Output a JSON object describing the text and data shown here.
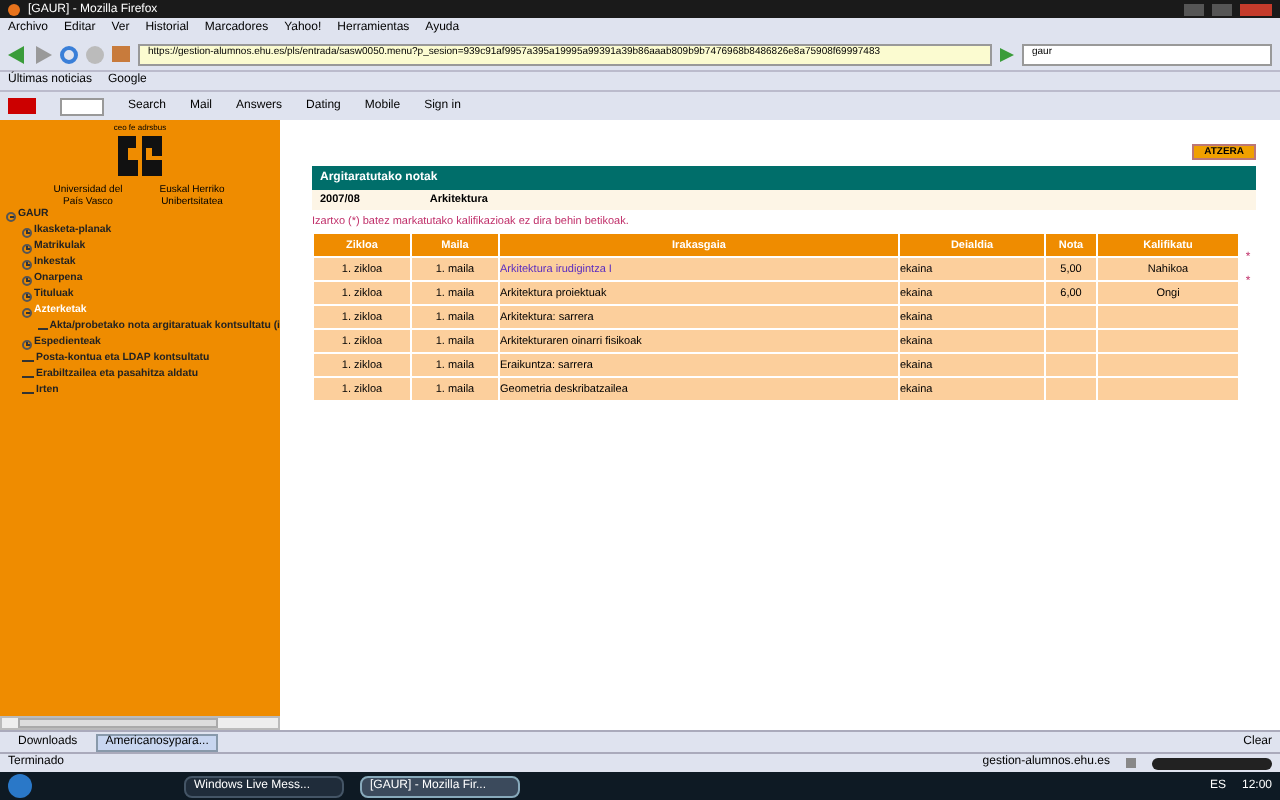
{
  "window": {
    "title": "[GAUR] - Mozilla Firefox"
  },
  "menu": [
    "Archivo",
    "Editar",
    "Ver",
    "Historial",
    "Marcadores",
    "Yahoo!",
    "Herramientas",
    "Ayuda"
  ],
  "address": {
    "value": "https://gestion-alumnos.ehu.es/pls/entrada/sasw0050.menu?p_sesion=939c91af9957a395a19995a99391a39b86aaab809b9b7476968b8486826e8a75908f69997483"
  },
  "search": {
    "value": "gaur"
  },
  "bookmarks": [
    "Últimas noticias",
    "Google"
  ],
  "yahoo_toolbar": [
    "Search",
    "Mail",
    "Answers",
    "Dating",
    "Mobile",
    "Sign in"
  ],
  "logo": {
    "top": "ceo fe adrsbus",
    "left": "Universidad del País Vasco",
    "right": "Euskal Herriko Unibertsitatea"
  },
  "tree": {
    "label": "GAUR",
    "expanded": true,
    "children": [
      {
        "label": "Ikasketa-planak",
        "expanded": false,
        "selected": false
      },
      {
        "label": "Matrikulak",
        "expanded": false,
        "selected": false
      },
      {
        "label": "Inkestak",
        "expanded": false,
        "selected": false
      },
      {
        "label": "Onarpena",
        "expanded": false,
        "selected": false
      },
      {
        "label": "Tituluak",
        "expanded": false,
        "selected": false
      },
      {
        "label": "Azterketak",
        "expanded": true,
        "selected": true,
        "children": [
          {
            "label": "Akta/probetako nota argitaratuak kontsultatu (i",
            "selected": false
          }
        ]
      },
      {
        "label": "Espedienteak",
        "expanded": false,
        "selected": false
      },
      {
        "label": "Posta-kontua eta LDAP kontsultatu",
        "selected": false
      },
      {
        "label": "Erabiltzailea eta pasahitza aldatu",
        "selected": false
      },
      {
        "label": "Irten",
        "selected": false
      }
    ]
  },
  "back_button": "ATZERA",
  "panel_title": "Argitaratutako notak",
  "year": "2007/08",
  "degree": "Arkitektura",
  "note": "Izartxo (*) batez markatutako kalifikazioak ez dira behin betikoak.",
  "table": {
    "columns": [
      "Zikloa",
      "Maila",
      "Irakasgaia",
      "Deialdia",
      "Nota",
      "Kalifikatu"
    ],
    "rows": [
      {
        "cells": [
          "1. zikloa",
          "1. maila",
          "Arkitektura irudigintza I",
          "ekaina",
          "5,00",
          "Nahikoa"
        ],
        "link": true,
        "mark": "*"
      },
      {
        "cells": [
          "1. zikloa",
          "1. maila",
          "Arkitektura proiektuak",
          "ekaina",
          "6,00",
          "Ongi"
        ],
        "link": false,
        "mark": "*"
      },
      {
        "cells": [
          "1. zikloa",
          "1. maila",
          "Arkitektura: sarrera",
          "ekaina",
          "",
          ""
        ],
        "link": false
      },
      {
        "cells": [
          "1. zikloa",
          "1. maila",
          "Arkitekturaren oinarri fisikoak",
          "ekaina",
          "",
          ""
        ],
        "link": false
      },
      {
        "cells": [
          "1. zikloa",
          "1. maila",
          "Eraikuntza: sarrera",
          "ekaina",
          "",
          ""
        ],
        "link": false
      },
      {
        "cells": [
          "1. zikloa",
          "1. maila",
          "Geometria deskribatzailea",
          "ekaina",
          "",
          ""
        ],
        "link": false
      }
    ]
  },
  "downloads": [
    {
      "label": "Downloads",
      "selected": false
    },
    {
      "label": "Americanosypara...",
      "selected": true
    }
  ],
  "clear_button": "Clear",
  "status": {
    "text": "Terminado",
    "host": "gestion-alumnos.ehu.es"
  },
  "taskbar": {
    "tasks": [
      {
        "label": "Windows Live Mess...",
        "selected": false
      },
      {
        "label": "[GAUR] - Mozilla Fir...",
        "selected": true
      }
    ],
    "lang": "ES",
    "clock": "12:00"
  }
}
